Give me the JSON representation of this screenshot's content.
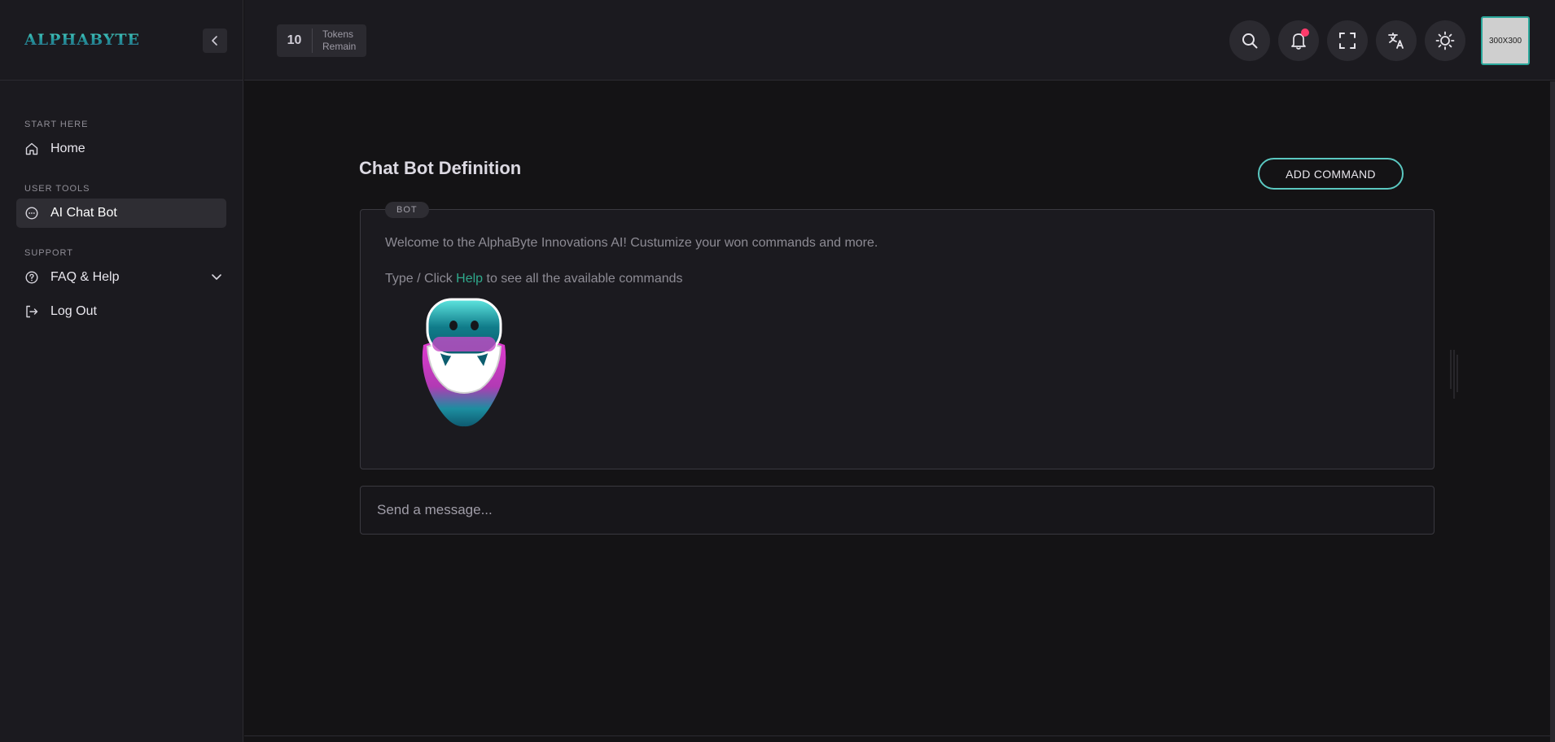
{
  "brand": {
    "logo_text": "ALPHABYTE"
  },
  "sidebar": {
    "sections": [
      {
        "title": "START HERE",
        "items": [
          {
            "label": "Home",
            "icon": "home-icon"
          }
        ]
      },
      {
        "title": "USER TOOLS",
        "items": [
          {
            "label": "AI Chat Bot",
            "icon": "chat-icon",
            "active": true
          }
        ]
      },
      {
        "title": "SUPPORT",
        "items": [
          {
            "label": "FAQ & Help",
            "icon": "help-circle-icon",
            "expandable": true
          },
          {
            "label": "Log Out",
            "icon": "logout-icon"
          }
        ]
      }
    ]
  },
  "header": {
    "tokens": {
      "count": "10",
      "label_line1": "Tokens",
      "label_line2": "Remain"
    },
    "buttons": [
      "search-icon",
      "bell-icon",
      "fullscreen-icon",
      "translate-icon",
      "sun-icon"
    ],
    "notification_dot_color": "#ff3b6b",
    "avatar_text": "300X300"
  },
  "main": {
    "title": "Chat Bot Definition",
    "add_command_label": "ADD COMMAND",
    "bot_tag": "BOT",
    "welcome": "Welcome to the AlphaByte Innovations AI! Custumize your won commands and more.",
    "help_prefix": "Type / Click ",
    "help_link": "Help",
    "help_suffix": " to see all the available commands",
    "input_placeholder": "Send a message..."
  },
  "colors": {
    "accent_teal": "#5bc8c1",
    "link_green": "#2fa98c",
    "bg_dark": "#141315",
    "panel": "#1b1a1f"
  }
}
